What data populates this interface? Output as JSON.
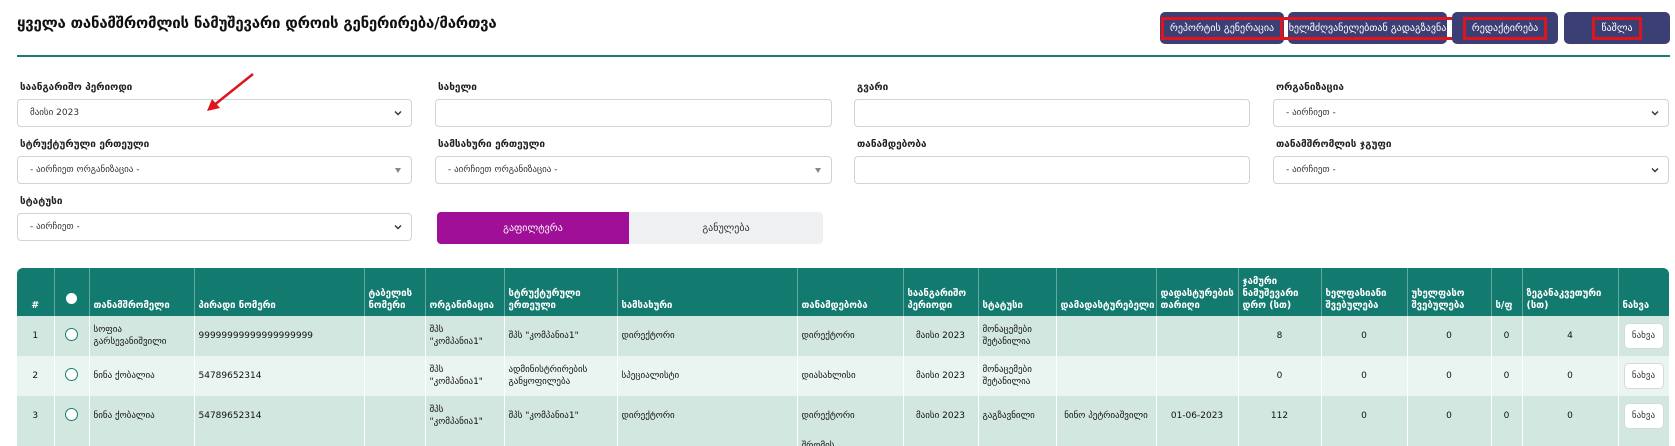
{
  "page": {
    "title": "ყველა თანამშრომლის ნამუშევარი დროის გენერირება/მართვა"
  },
  "toolbar": {
    "report_label": "რეპორტის გენერაცია",
    "send_label": "ხელმძღვანელებთან გადაგზავნა",
    "edit_label": "რედაქტირება",
    "delete_label": "წაშლა"
  },
  "filters": {
    "period_label": "საანგარიშო პერიოდი",
    "period_value": "მაისი 2023",
    "name_label": "სახელი",
    "surname_label": "გვარი",
    "org_label": "ორგანიზაცია",
    "org_value": "- აირჩიეთ -",
    "struct_label": "სტრუქტურული ერთეული",
    "struct_value": "- აირჩიეთ ორგანიზაცია -",
    "service_label": "სამსახური ერთეული",
    "service_value": "- აირჩიეთ ორგანიზაცია -",
    "position_label": "თანამდებობა",
    "group_label": "თანამშრომლის ჯგუფი",
    "group_value": "- აირჩიეთ -",
    "status_label": "სტატუსი",
    "status_value": "- აირჩიეთ -",
    "filter_btn": "გაფილტვრა",
    "clear_btn": "განულება"
  },
  "table": {
    "headers": [
      "#",
      "",
      "თანამშრომელი",
      "პირადი ნომერი",
      "ტაბელის ნომერი",
      "ორგანიზაცია",
      "სტრუქტურული ერთეული",
      "სამსახური",
      "თანამდებობა",
      "საანგარიშო პერიოდი",
      "სტატუსი",
      "დამადასტურებელი",
      "დადასტურების თარიღი",
      "ჯამური ნამუშევარი დრო (სთ)",
      "ხელფასიანი შვებულება",
      "უხელფასო შვებულება",
      "ს/ფ",
      "ზეგანაკვეთური (სთ)",
      "ნახვა"
    ],
    "rows": [
      [
        "1",
        "",
        "სოფია გარსევანიშვილი",
        "99999999999999999999",
        "",
        "შპს \"კომპანია1\"",
        "შპს \"კომპანია1\"",
        "დირექტორი",
        "დირექტორი",
        "მაისი 2023",
        "მონაცემები შეტანილია",
        "",
        "",
        "8",
        "0",
        "0",
        "0",
        "4",
        "ნახვა"
      ],
      [
        "2",
        "",
        "ნინა ქობალია",
        "54789652314",
        "",
        "შპს \"კომპანია1\"",
        "ადმინისტრირების განყოფილება",
        "სპეციალისტი",
        "დიასახლისი",
        "მაისი 2023",
        "მონაცემები შეტანილია",
        "",
        "",
        "0",
        "0",
        "0",
        "0",
        "0",
        "ნახვა"
      ],
      [
        "3",
        "",
        "ნინა ქობალია",
        "54789652314",
        "",
        "შპს \"კომპანია1\"",
        "შპს \"კომპანია1\"",
        "დირექტორი",
        "დირექტორი",
        "მაისი 2023",
        "გაგზავნილი",
        "ნინო პეტრიაშვილი",
        "01-06-2023",
        "112",
        "0",
        "0",
        "0",
        "0",
        "ნახვა"
      ],
      [
        "",
        "",
        "",
        "",
        "",
        "",
        "",
        "",
        "შრომის",
        "",
        "",
        "",
        "",
        "",
        "",
        "",
        "",
        "",
        ""
      ]
    ]
  }
}
